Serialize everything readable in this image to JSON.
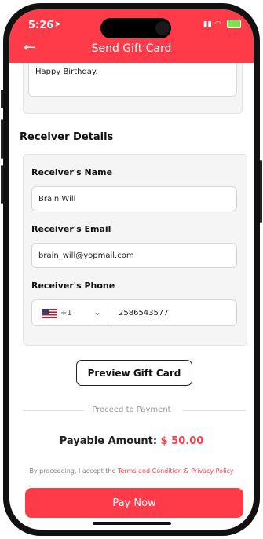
{
  "status_bar": {
    "time": "5:26"
  },
  "header": {
    "title": "Send Gift Card"
  },
  "message": {
    "text": "Happy Birthday."
  },
  "receiver": {
    "section_title": "Receiver Details",
    "name_label": "Receiver's Name",
    "name_value": "Brain Will",
    "email_label": "Receiver's Email",
    "email_value": "brain_will@yopmail.com",
    "phone_label": "Receiver's Phone",
    "country_code": "+1",
    "phone_value": "2586543577"
  },
  "actions": {
    "preview_label": "Preview Gift Card",
    "proceed_divider": "Proceed to Payment",
    "payable_label": "Payable Amount:",
    "payable_amount": "$ 50.00",
    "terms_prefix": "By proceeding, I accept the",
    "terms_link": "Terms and Condition & Privacy Policy",
    "pay_label": "Pay Now"
  },
  "colors": {
    "accent": "#ff3b4a"
  }
}
